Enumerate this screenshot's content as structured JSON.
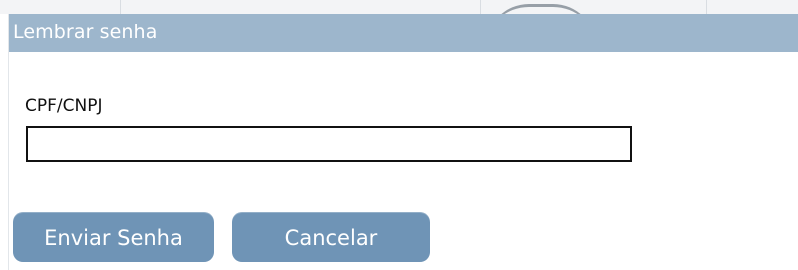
{
  "dialog": {
    "title": "Lembrar senha",
    "field_label": "CPF/CNPJ",
    "field_value": "",
    "send_button_label": "Enviar Senha",
    "cancel_button_label": "Cancelar"
  },
  "colors": {
    "titlebar": "#9db6cc",
    "button": "#6f94b6",
    "button_text": "#ffffff"
  }
}
